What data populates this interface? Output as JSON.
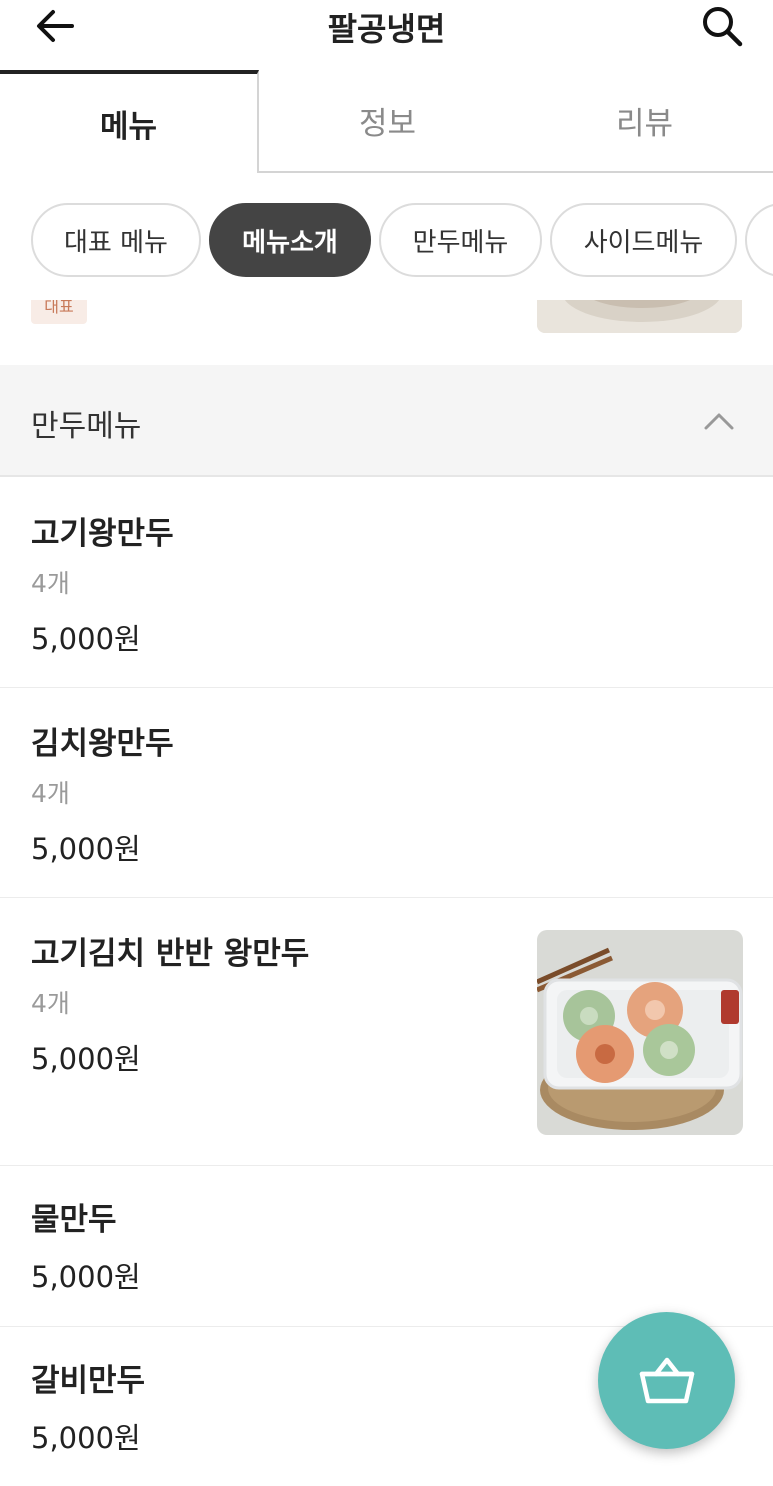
{
  "header": {
    "title": "팔공냉면",
    "back_icon": "arrow-left-icon",
    "search_icon": "search-icon"
  },
  "tabs": [
    {
      "label": "메뉴",
      "active": true
    },
    {
      "label": "정보",
      "active": false
    },
    {
      "label": "리뷰",
      "active": false
    }
  ],
  "chips": [
    {
      "label": "대표 메뉴",
      "active": false
    },
    {
      "label": "메뉴소개",
      "active": true
    },
    {
      "label": "만두메뉴",
      "active": false
    },
    {
      "label": "사이드메뉴",
      "active": false
    }
  ],
  "previous_item": {
    "badge": "대표"
  },
  "section": {
    "title": "만두메뉴",
    "expanded": true
  },
  "items": [
    {
      "name": "고기왕만두",
      "desc": "4개",
      "price": "5,000원"
    },
    {
      "name": "김치왕만두",
      "desc": "4개",
      "price": "5,000원"
    },
    {
      "name": "고기김치 반반 왕만두",
      "desc": "4개",
      "price": "5,000원",
      "has_image": true
    },
    {
      "name": "물만두",
      "price": "5,000원"
    },
    {
      "name": "갈비만두",
      "price": "5,000원"
    }
  ],
  "cart": {
    "icon": "shopping-basket-icon",
    "color": "#5ebdb6"
  },
  "colors": {
    "active_chip_bg": "#444444",
    "active_tab_indicator": "#222222",
    "section_bg": "#f5f5f5"
  }
}
